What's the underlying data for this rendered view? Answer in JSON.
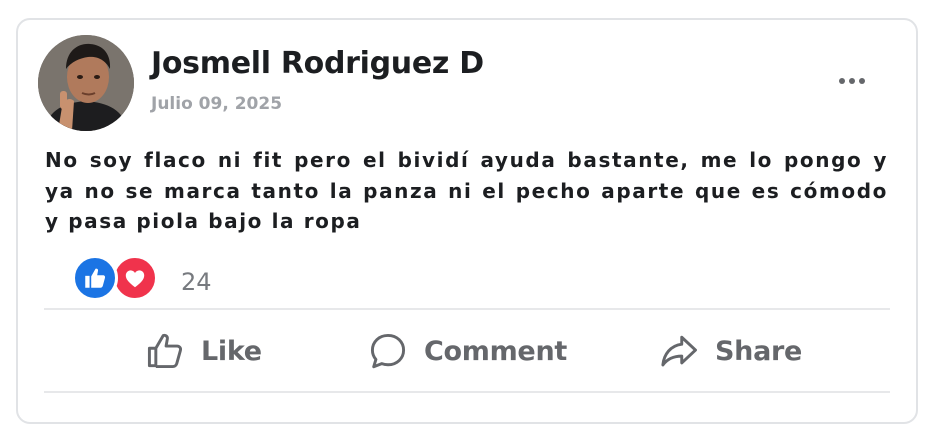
{
  "post": {
    "author": "Josmell Rodriguez D",
    "date": "Julio 09, 2025",
    "text": "No soy flaco ni fit pero el bividí ayuda bastante, me lo pongo y ya no se marca tanto la panza ni el pecho aparte que es cómodo y pasa piola bajo la ropa"
  },
  "reactions": {
    "icons": [
      "like-reaction-icon",
      "love-reaction-icon"
    ],
    "count": "24",
    "colors": {
      "like": "#1b74e4",
      "love": "#f0334c"
    }
  },
  "actions": {
    "like": "Like",
    "comment": "Comment",
    "share": "Share"
  },
  "icons": {
    "more": "more-options-icon",
    "like": "thumbs-up-icon",
    "comment": "speech-bubble-icon",
    "share": "share-arrow-icon"
  }
}
